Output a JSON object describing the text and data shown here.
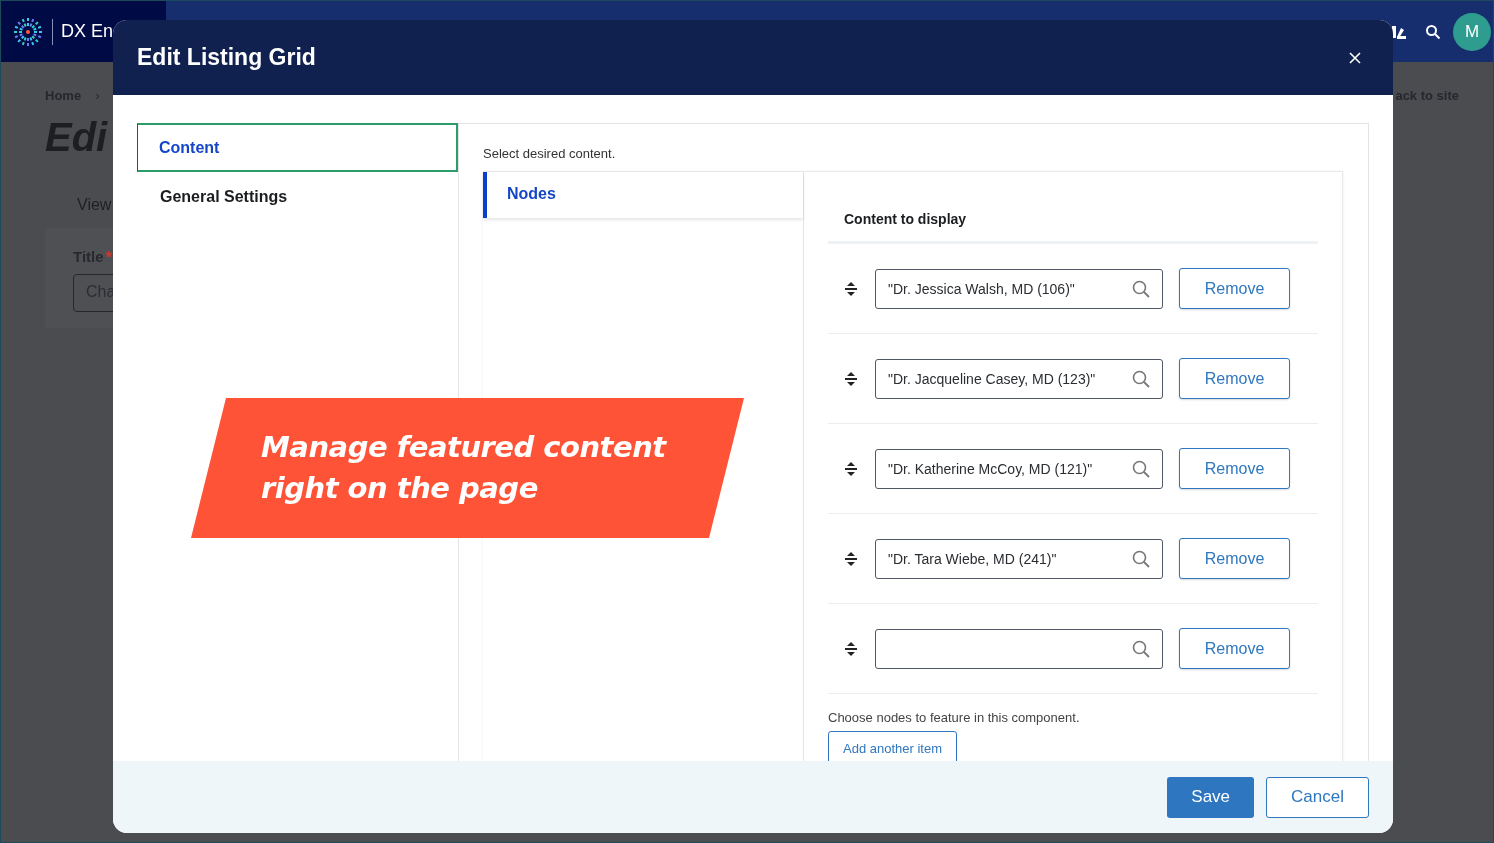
{
  "header": {
    "brand": "DX En",
    "avatar": "M"
  },
  "background_page": {
    "breadcrumb": "Home",
    "breadcrumb_separator": "›",
    "title": "Edi",
    "tab": "View",
    "field_label": "Title",
    "required_mark": "*",
    "field_value": "Cha",
    "back_link": "ack to site"
  },
  "dialog": {
    "title": "Edit Listing Grid",
    "nav": [
      {
        "label": "Content",
        "selected": true
      },
      {
        "label": "General Settings",
        "selected": false
      }
    ],
    "instruction": "Select desired content.",
    "subtabs": [
      {
        "label": "Nodes",
        "selected": true
      }
    ],
    "list_heading": "Content to display",
    "items": [
      {
        "value": "\"Dr. Jessica Walsh, MD (106)\"",
        "action": "Remove"
      },
      {
        "value": "\"Dr. Jacqueline Casey, MD (123)\"",
        "action": "Remove"
      },
      {
        "value": "\"Dr. Katherine McCoy, MD (121)\"",
        "action": "Remove"
      },
      {
        "value": "\"Dr. Tara Wiebe, MD (241)\"",
        "action": "Remove"
      },
      {
        "action": "Remove"
      }
    ],
    "help": "Choose nodes to feature in this component.",
    "add_button": "Add another item",
    "buttons": [
      {
        "label": "Save",
        "kind": "primary"
      },
      {
        "label": "Cancel",
        "kind": "secondary"
      }
    ]
  },
  "banner": {
    "lines": [
      "Manage featured content",
      "right on the page"
    ]
  }
}
